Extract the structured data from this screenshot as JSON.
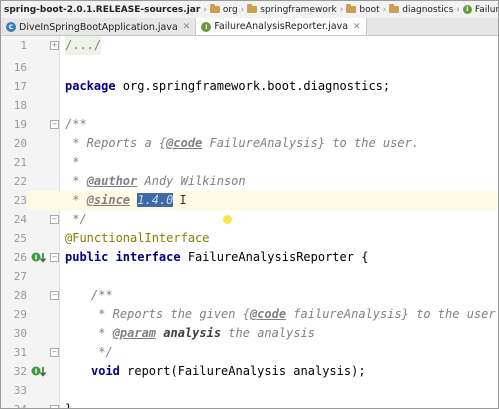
{
  "breadcrumb": {
    "items": [
      "spring-boot-2.0.1.RELEASE-sources.jar",
      "org",
      "springframework",
      "boot",
      "diagnostics",
      "FailureAnalysisReporter"
    ]
  },
  "tabs": [
    {
      "label": "DiveInSpringBootApplication.java",
      "active": false
    },
    {
      "label": "FailureAnalysisReporter.java",
      "active": true
    }
  ],
  "editor": {
    "line_numbers": [
      "1",
      "16",
      "17",
      "18",
      "19",
      "20",
      "21",
      "22",
      "23",
      "24",
      "25",
      "26",
      "27",
      "28",
      "29",
      "30",
      "31",
      "32",
      "33",
      "34"
    ],
    "current_line": "23",
    "code": {
      "l1": "/.../",
      "l17_kw": "package",
      "l17_rest": " org.springframework.boot.diagnostics;",
      "l19": "/**",
      "l20_a": " * Reports a {",
      "l20_tag": "@code",
      "l20_b": " FailureAnalysis} to the user.",
      "l21": " *",
      "l22_a": " * ",
      "l22_tag": "@author",
      "l22_b": " Andy Wilkinson",
      "l23_a": " * ",
      "l23_tag": "@since",
      "l23_sp": " ",
      "l23_sel": "1.4.0",
      "l23_cursor": "I",
      "l24": " */",
      "l25": "@FunctionalInterface",
      "l26_kw": "public interface",
      "l26_rest": " FailureAnalysisReporter {",
      "l28": "/**",
      "l29_a": " * Reports the given {",
      "l29_tag": "@code",
      "l29_b": " failureAnalysis} to the user.",
      "l30_a": " * ",
      "l30_tag": "@param",
      "l30_p": " analysis",
      "l30_b": " the analysis",
      "l31": " */",
      "l32_kw": "void",
      "l32_rest": " report(FailureAnalysis analysis);",
      "l34": "}"
    }
  },
  "colors": {
    "keyword": "#000080",
    "comment": "#808080",
    "annotation": "#808000",
    "selection": "#3e6aa8",
    "current_line": "#fefbe2"
  },
  "icons": [
    "folder-icon",
    "interface-icon",
    "class-icon",
    "implemented-method-icon",
    "fold-icon",
    "close-icon"
  ]
}
